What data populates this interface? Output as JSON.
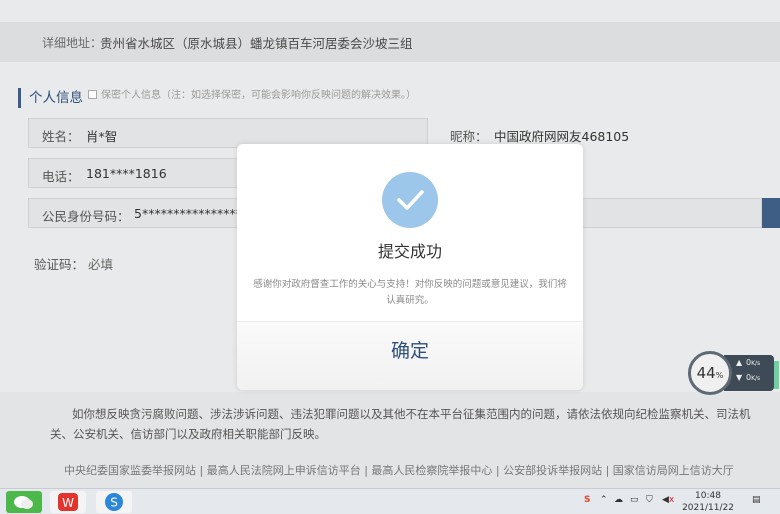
{
  "form": {
    "address_label": "详细地址：",
    "address_value": "贵州省水城区（原水城县）蟠龙镇百车河居委会沙坡三组",
    "section_title": "个人信息",
    "privacy_text": "保密个人信息（注：如选择保密，可能会影响你反映问题的解决效果。）",
    "name_label": "姓名：",
    "name_value": "肖*智",
    "nickname_label": "昵称：",
    "nickname_value": "中国政府网网友468105",
    "phone_label": "电话：",
    "phone_value": "181****1816",
    "id_label": "公民身份号码：",
    "id_value": "5****************9",
    "captcha_label": "验证码：",
    "captcha_placeholder": "必填"
  },
  "notice": {
    "text": "如你想反映贪污腐败问题、涉法涉诉问题、违法犯罪问题以及其他不在本平台征集范围内的问题，请依法依规向纪检监察机关、司法机关、公安机关、信访部门以及政府相关职能部门反映。",
    "links": "中央纪委国家监委举报网站 | 最高人民法院网上申诉信访平台 | 最高人民检察院举报中心 | 公安部投诉举报网站 | 国家信访局网上信访大厅"
  },
  "modal": {
    "title": "提交成功",
    "message": "感谢你对政府督查工作的关心与支持！对你反映的问题或意见建议，我们将认真研究。",
    "confirm_label": "确定"
  },
  "speed_widget": {
    "percent": "44",
    "percent_unit": "%",
    "upload": "0",
    "download": "0",
    "unit": "K/s"
  },
  "taskbar": {
    "time": "10:48",
    "date": "2021/11/22",
    "ime": "S",
    "volume_label": "x"
  },
  "colors": {
    "accent": "#2f4f7a",
    "check_circle": "#9cc7ea"
  }
}
